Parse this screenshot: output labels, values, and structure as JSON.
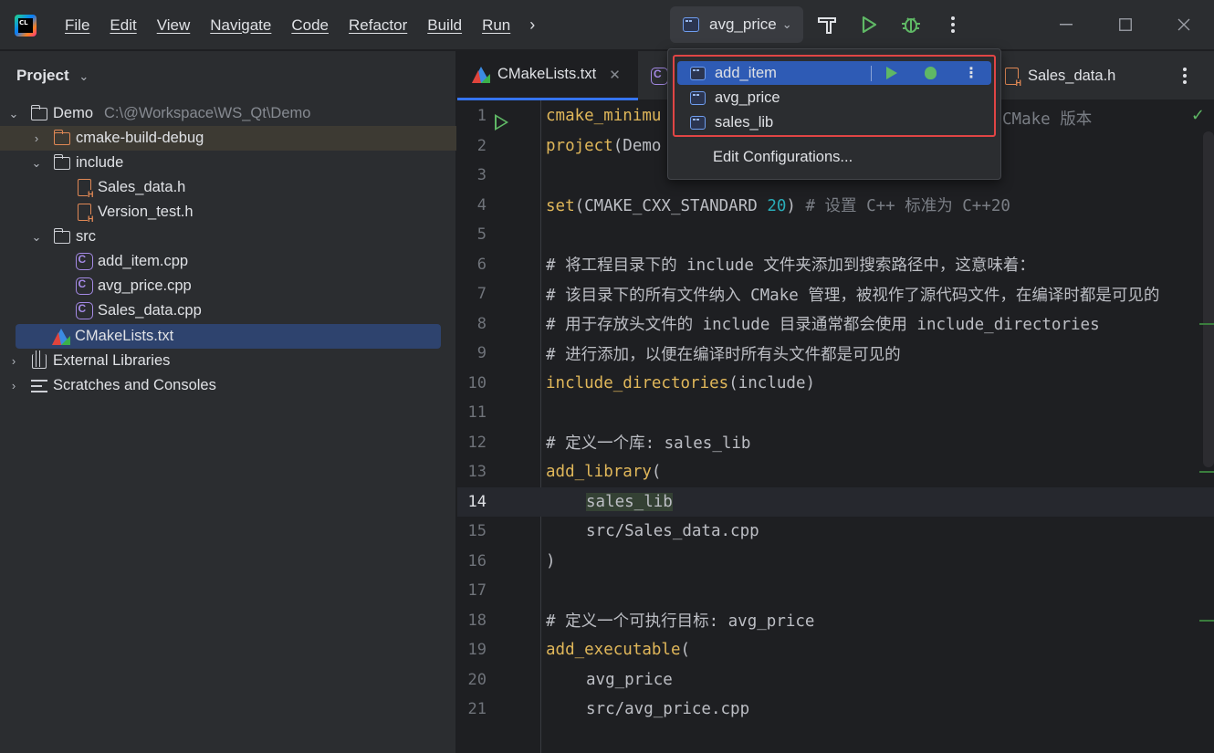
{
  "titlebar": {
    "logo_text": "CL",
    "menu": [
      {
        "label": "File"
      },
      {
        "label": "Edit"
      },
      {
        "label": "View"
      },
      {
        "label": "Navigate"
      },
      {
        "label": "Code"
      },
      {
        "label": "Refactor"
      },
      {
        "label": "Build"
      },
      {
        "label": "Run"
      }
    ],
    "more_menu": "›",
    "run_config": "avg_price"
  },
  "project": {
    "title": "Project",
    "tree": [
      {
        "label": "Demo",
        "path": "C:\\@Workspace\\WS_Qt\\Demo"
      },
      {
        "label": "cmake-build-debug"
      },
      {
        "label": "include"
      },
      {
        "label": "Sales_data.h"
      },
      {
        "label": "Version_test.h"
      },
      {
        "label": "src"
      },
      {
        "label": "add_item.cpp"
      },
      {
        "label": "avg_price.cpp"
      },
      {
        "label": "Sales_data.cpp"
      },
      {
        "label": "CMakeLists.txt"
      },
      {
        "label": "External Libraries"
      },
      {
        "label": "Scratches and Consoles"
      }
    ]
  },
  "tabs": {
    "active": "CMakeLists.txt",
    "right": "Sales_data.h"
  },
  "popup": {
    "items": [
      {
        "label": "add_item"
      },
      {
        "label": "avg_price"
      },
      {
        "label": "sales_lib"
      }
    ],
    "edit_configurations": "Edit Configurations..."
  },
  "editor": {
    "line_numbers": [
      "1",
      "2",
      "3",
      "4",
      "5",
      "6",
      "7",
      "8",
      "9",
      "10",
      "11",
      "12",
      "13",
      "14",
      "15",
      "16",
      "17",
      "18",
      "19",
      "20",
      "21"
    ],
    "lines": {
      "l1_a": "cmake_minimu",
      "l1_b": "CMake 版本",
      "l2_a": "project",
      "l2_b": "(Demo",
      "l4_a": "set",
      "l4_b": "(CMAKE_CXX_STANDARD ",
      "l4_c": "20",
      "l4_d": ") ",
      "l4_e": "# 设置 C++ 标准为 C++20",
      "l6": "# 将工程目录下的 include 文件夹添加到搜索路径中，这意味着：",
      "l7": "# 该目录下的所有文件纳入 CMake 管理，被视作了源代码文件，在编译时都是可见的",
      "l8": "# 用于存放头文件的 include 目录通常都会使用 include_directories",
      "l9": "# 进行添加，以便在编译时所有头文件都是可见的",
      "l10_a": "include_directories",
      "l10_b": "(include)",
      "l12": "# 定义一个库: sales_lib",
      "l13_a": "add_library",
      "l13_b": "(",
      "l14": "sales_lib",
      "l15": "src/Sales_data.cpp",
      "l16": ")",
      "l18": "# 定义一个可执行目标: avg_price",
      "l19_a": "add_executable",
      "l19_b": "(",
      "l20": "avg_price",
      "l21": "src/avg_price.cpp"
    }
  },
  "colors": {
    "accent": "#3574f0",
    "run_green": "#5fb865",
    "highlight_red": "#e04545"
  }
}
